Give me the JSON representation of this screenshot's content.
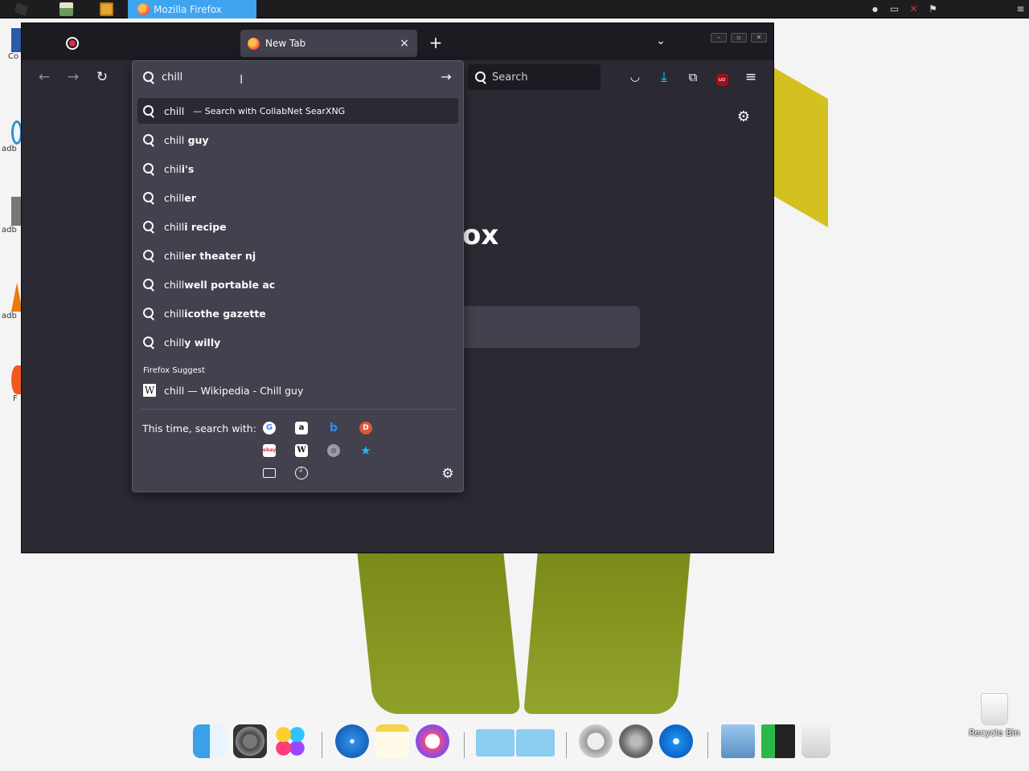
{
  "taskbar": {
    "active_task": "Mozilla Firefox",
    "tray_icons": [
      "network-icon",
      "volume-muted-icon",
      "flag-icon"
    ]
  },
  "desktop": {
    "icons": [
      "Co",
      "adb",
      "adb",
      "adb",
      "F"
    ],
    "recycle_bin": "Recycle Bin"
  },
  "browser": {
    "tab_title": "New Tab",
    "tab_close": "×",
    "new_tab": "+",
    "search_placeholder": "Search",
    "content_brand_partial": "ox",
    "urlbar": {
      "value": "chill",
      "suggestions": [
        {
          "text": "chill",
          "suffix": "— Search with CollabNet SearXNG",
          "selected": true
        },
        {
          "text": "chill guy",
          "bold": " guy",
          "base": "chill"
        },
        {
          "text": "chili's",
          "base": "chil",
          "bold": "i's"
        },
        {
          "text": "chiller",
          "base": "chill",
          "bold": "er"
        },
        {
          "text": "chilli recipe",
          "base": "chill",
          "bold": "i recipe"
        },
        {
          "text": "chiller theater nj",
          "base": "chill",
          "bold": "er theater nj"
        },
        {
          "text": "chillwell portable ac",
          "base": "chill",
          "bold": "well portable ac"
        },
        {
          "text": "chillicothe gazette",
          "base": "chill",
          "bold": "icothe gazette"
        },
        {
          "text": "chilly willy",
          "base": "chill",
          "bold": "y willy"
        }
      ],
      "firefox_suggest_label": "Firefox Suggest",
      "wiki_suggestion": "chill — Wikipedia - Chill guy",
      "one_off_label": "This time, search with:",
      "engines": [
        "Google",
        "Amazon",
        "Bing",
        "DuckDuckGo",
        "eBay",
        "Wikipedia",
        "SearXNG",
        "Bookmarks",
        "Tabs",
        "History"
      ]
    }
  },
  "dock": {
    "apps": [
      "Finder",
      "System Preferences",
      "Game Center",
      "Safari",
      "Notes",
      "iTunes",
      "Folder",
      "Applications",
      "Power",
      "Launchpad",
      "App Store",
      "Preview",
      "Task Manager",
      "Trash"
    ]
  }
}
